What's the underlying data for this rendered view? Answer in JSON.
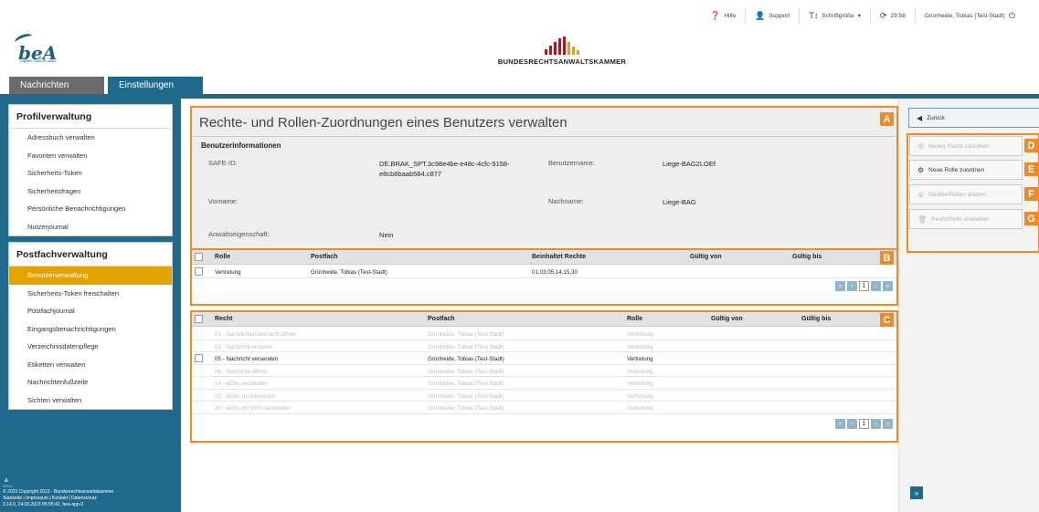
{
  "topbar": {
    "help": "Hilfe",
    "support": "Support",
    "font_size": "Schriftgröße",
    "timer": "29:58",
    "user": "Grünheide, Tobias (Test-Stadt)"
  },
  "header": {
    "logo_text": "beA",
    "logo_sub": "Digitale Zukunft Justiz",
    "brand": "BUNDESRECHTSANWALTSKAMMER"
  },
  "tabs": [
    "Nachrichten",
    "Einstellungen"
  ],
  "sidebar": {
    "profil": {
      "title": "Profilverwaltung",
      "items": [
        "Adressbuch verwalten",
        "Favoriten verwalten",
        "Sicherheits-Token",
        "Sicherheitsfragen",
        "Persönliche Benachrichtigungen",
        "Nutzerjournal"
      ]
    },
    "postfach": {
      "title": "Postfachverwaltung",
      "items": [
        "Benutzerverwaltung",
        "Sicherheits-Token freischalten",
        "Postfachjournal",
        "Eingangsbenachrichtigungen",
        "Verzeichnisdatenpflege",
        "Etiketten verwalten",
        "Nachrichtenfußzeile",
        "Sichten verwalten"
      ]
    },
    "footer": {
      "logo": "BRAK",
      "copyright": "© 2023 Copyright 2015 - Bundesrechtsanwaltskammer",
      "links": "Startseite | Impressum | Kontakt | Datenschutz",
      "version": "3.14.0, 24.03.2023 05:05:42, bea-app-0"
    }
  },
  "main": {
    "title": "Rechte- und Rollen-Zuordnungen eines Benutzers verwalten",
    "info_section": "Benutzerinformationen",
    "safe_id_label": "SAFE-ID:",
    "safe_id_value": "DE.BRAK_SPT.3c98e4be-e48c-4cfc-9158-e8cb8baab584.c877",
    "username_label": "Benutzername:",
    "username_value": "Liege-BAG2LOEf",
    "firstname_label": "Vorname:",
    "lastname_label": "Nachname:",
    "lastname_value": "Liege-BAG",
    "lawyer_label": "Anwaltseigenschaft:",
    "lawyer_value": "Nein",
    "markers": [
      "A",
      "B",
      "C",
      "D",
      "E",
      "F",
      "G"
    ]
  },
  "roles_table": {
    "headers": [
      "Rolle",
      "Postfach",
      "Beinhaltet Rechte",
      "Gültig von",
      "Gültig bis"
    ],
    "rows": [
      {
        "rolle": "Vertretung",
        "postfach": "Grünheide, Tobias (Test-Stadt)",
        "rechte": "01,03,05,14,15,30",
        "von": "",
        "bis": ""
      }
    ],
    "page": "1"
  },
  "rights_table": {
    "headers": [
      "Recht",
      "Postfach",
      "Rolle",
      "Gültig von",
      "Gültig bis"
    ],
    "rows": [
      {
        "recht": "01 - Nachrichtenübersicht öffnen",
        "postfach": "Grünheide, Tobias (Test-Stadt)",
        "rolle": "Vertretung",
        "enabled": false
      },
      {
        "recht": "03 - Nachricht erstellen",
        "postfach": "Grünheide, Tobias (Test-Stadt)",
        "rolle": "Vertretung",
        "enabled": false
      },
      {
        "recht": "05 - Nachricht versenden",
        "postfach": "Grünheide, Tobias (Test-Stadt)",
        "rolle": "Vertretung",
        "enabled": true
      },
      {
        "recht": "06 - Nachricht öffnen",
        "postfach": "Grünheide, Tobias (Test-Stadt)",
        "rolle": "Vertretung",
        "enabled": false
      },
      {
        "recht": "14 - eEBs versenden",
        "postfach": "Grünheide, Tobias (Test-Stadt)",
        "rolle": "Vertretung",
        "enabled": false
      },
      {
        "recht": "15 - eEBs zurückweisen",
        "postfach": "Grünheide, Tobias (Test-Stadt)",
        "rolle": "Vertretung",
        "enabled": false
      },
      {
        "recht": "30 - eEBs mit VHN versenden",
        "postfach": "Grünheide, Tobias (Test-Stadt)",
        "rolle": "Vertretung",
        "enabled": false
      }
    ],
    "page": "1"
  },
  "actions": {
    "back": "Zurück",
    "new_right": "Neues Recht zuordnen",
    "new_role": "Neue Rolle zuordnen",
    "change": "Rechte/Rollen ändern",
    "revoke": "Recht/Rolle entziehen"
  },
  "colors": {
    "brand_blue": "#1f6a8c",
    "highlight_orange": "#f08a24",
    "selected_item": "#e3a400",
    "brak_red": "#b5121b"
  }
}
